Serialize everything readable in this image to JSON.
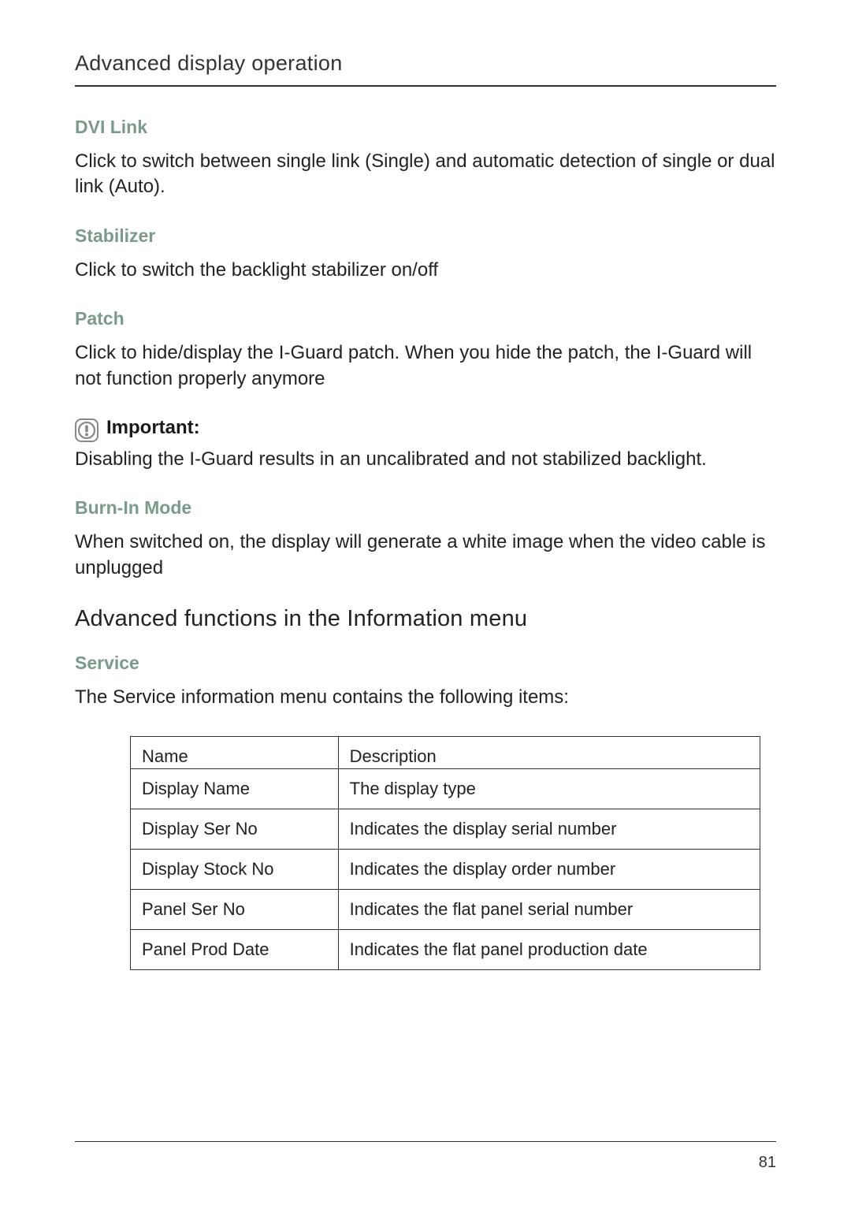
{
  "header": {
    "title": "Advanced display operation"
  },
  "sections": {
    "dvi_link": {
      "heading": "DVI Link",
      "body": "Click to switch between single link (Single) and automatic detection of single or dual link (Auto)."
    },
    "stabilizer": {
      "heading": "Stabilizer",
      "body": "Click to switch the backlight stabilizer on/off"
    },
    "patch": {
      "heading": "Patch",
      "body": "Click to hide/display the I-Guard patch. When you hide the patch, the I-Guard will not function properly anymore"
    },
    "important": {
      "label": "Important:",
      "body": "Disabling the I-Guard results in an uncalibrated and not stabilized backlight."
    },
    "burn_in": {
      "heading": "Burn-In Mode",
      "body": "When switched on, the display will generate a white image when the video cable is unplugged"
    },
    "info_menu": {
      "title": "Advanced functions in the Information menu"
    },
    "service": {
      "heading": "Service",
      "body": "The Service information menu contains the following items:"
    }
  },
  "table": {
    "headers": {
      "name": "Name",
      "description": "Description"
    },
    "rows": [
      {
        "name": "Display Name",
        "description": "The display type"
      },
      {
        "name": "Display Ser No",
        "description": "Indicates the display serial number"
      },
      {
        "name": "Display Stock No",
        "description": "Indicates the display order number"
      },
      {
        "name": "Panel Ser No",
        "description": "Indicates the flat panel serial number"
      },
      {
        "name": "Panel Prod Date",
        "description": "Indicates the flat panel production date"
      }
    ]
  },
  "footer": {
    "page_number": "81"
  },
  "colors": {
    "heading_green": "#7a9a8a",
    "text": "#222",
    "rule": "#333"
  }
}
